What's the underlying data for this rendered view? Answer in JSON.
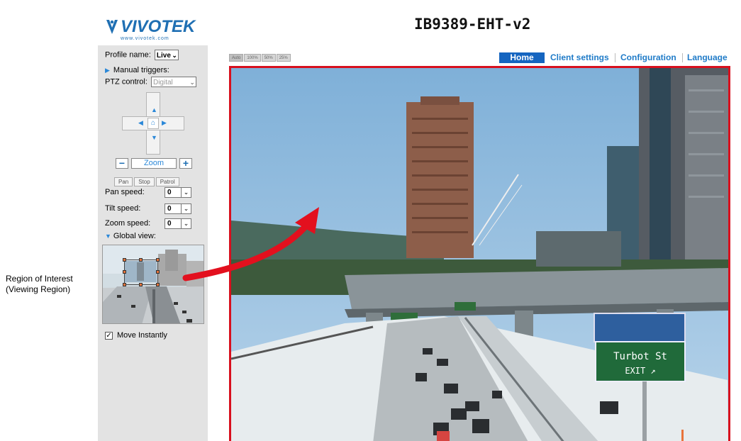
{
  "callout": {
    "line1": "Region of Interest",
    "line2": "(Viewing Region)"
  },
  "sidebar": {
    "logo_text": "VIVOTEK",
    "logo_sub": "www.vivotek.com",
    "profile_label": "Profile name:",
    "profile_value": "Live",
    "manual_triggers": "Manual triggers:",
    "ptz_label": "PTZ control:",
    "ptz_value": "Digital",
    "zoom_minus": "−",
    "zoom_label": "Zoom",
    "zoom_plus": "+",
    "pan_btn": "Pan",
    "stop_btn": "Stop",
    "patrol_btn": "Patrol",
    "pan_speed_label": "Pan speed:",
    "pan_speed_value": "0",
    "tilt_speed_label": "Tilt speed:",
    "tilt_speed_value": "0",
    "zoom_speed_label": "Zoom speed:",
    "zoom_speed_value": "0",
    "global_view": "Global view:",
    "move_instantly": "Move Instantly",
    "move_instantly_checked": true
  },
  "header": {
    "title": "IB9389-EHT-v2",
    "view_buttons": [
      "Auto",
      "100%",
      "50%",
      "25%"
    ],
    "nav": {
      "home": "Home",
      "client_settings": "Client settings",
      "configuration": "Configuration",
      "language": "Language"
    }
  },
  "video": {
    "sign_line1": "Turbot St",
    "sign_line2": "EXIT ↗"
  },
  "colors": {
    "accent_blue": "#1565c0",
    "link_blue": "#1f7bc8",
    "video_border": "#d8101e",
    "callout_arrow": "#e3101e",
    "roi_marker": "#e8743b",
    "sidebar_bg": "#e3e3e3"
  },
  "icons": [
    "vivotek-logo-icon",
    "arrow-up-icon",
    "arrow-down-icon",
    "arrow-left-icon",
    "arrow-right-icon",
    "home-icon",
    "triangle-right-icon",
    "triangle-down-icon",
    "checkmark-icon",
    "chevron-down-icon"
  ]
}
